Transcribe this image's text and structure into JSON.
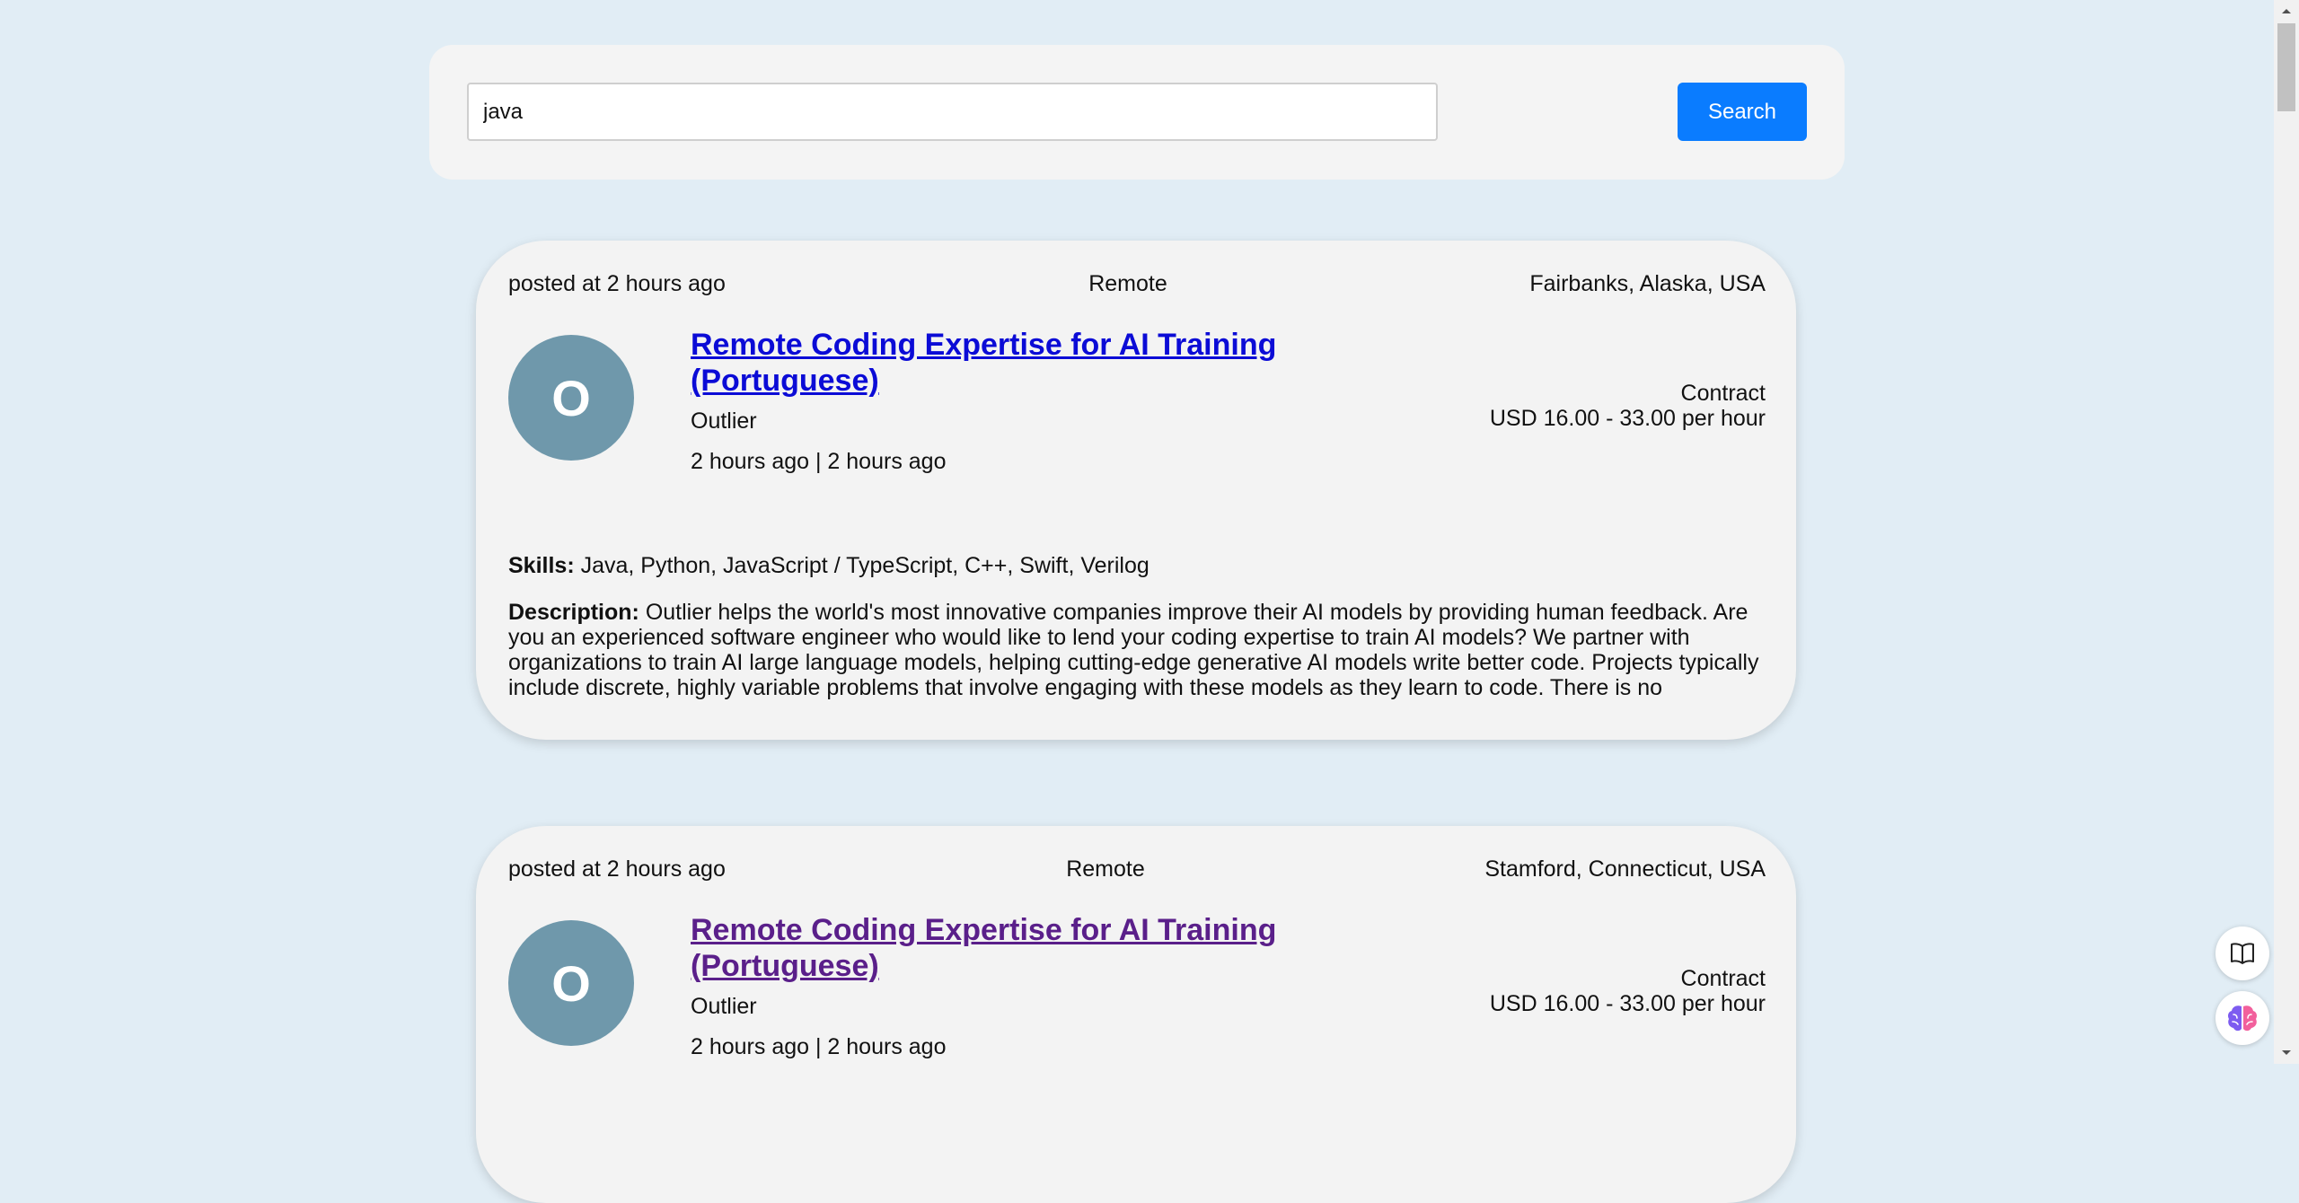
{
  "search": {
    "value": "java",
    "button_label": "Search"
  },
  "jobs": [
    {
      "posted": "posted at 2 hours ago",
      "work_type": "Remote",
      "location": "Fairbanks, Alaska, USA",
      "avatar_letter": "O",
      "title": "Remote Coding Expertise for AI Training (Portuguese)",
      "company": "Outlier",
      "times": "2 hours ago | 2 hours ago",
      "employment_type": "Contract",
      "salary": "USD 16.00 - 33.00 per hour",
      "skills_label": "Skills:",
      "skills": "Java, Python, JavaScript / TypeScript, C++, Swift, Verilog",
      "description_label": "Description:",
      "description": "Outlier helps the world's most innovative companies improve their AI models by providing human feedback. Are you an experienced software engineer who would like to lend your coding expertise to train AI models? We partner with organizations to train AI large language models, helping cutting-edge generative AI models write better code. Projects typically include discrete, highly variable problems that involve engaging with these models as they learn to code. There is no requirement for previous"
    },
    {
      "posted": "posted at 2 hours ago",
      "work_type": "Remote",
      "location": "Stamford, Connecticut, USA",
      "avatar_letter": "O",
      "title": "Remote Coding Expertise for AI Training (Portuguese)",
      "company": "Outlier",
      "times": "2 hours ago | 2 hours ago",
      "employment_type": "Contract",
      "salary": "USD 16.00 - 33.00 per hour"
    }
  ],
  "icons": {
    "book": "book-open-icon",
    "brain": "brain-icon"
  },
  "colors": {
    "accent": "#0a7cff",
    "link": "#0b0bd6",
    "visited_link": "#5a1f8a",
    "avatar": "#6f98ab",
    "page_background": "#e1edf5"
  }
}
